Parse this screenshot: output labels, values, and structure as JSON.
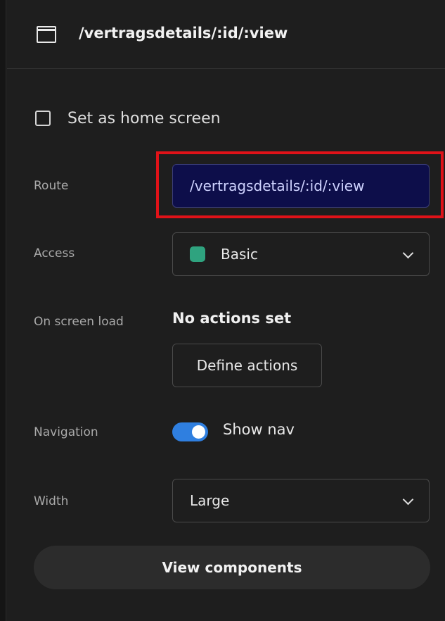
{
  "header": {
    "title": "/vertragsdetails/:id/:view",
    "icon": "screen-icon"
  },
  "home_screen": {
    "label": "Set as home screen",
    "checked": false
  },
  "route": {
    "label": "Route",
    "value": "/vertragsdetails/:id/:view"
  },
  "access": {
    "label": "Access",
    "value": "Basic",
    "dot_color": "#2fa37f"
  },
  "on_screen_load": {
    "label": "On screen load",
    "status": "No actions set",
    "button_label": "Define actions"
  },
  "navigation": {
    "label": "Navigation",
    "toggle_label": "Show nav",
    "enabled": true,
    "toggle_color": "#2f7fe0"
  },
  "width": {
    "label": "Width",
    "value": "Large"
  },
  "view_components_label": "View components",
  "colors": {
    "background": "#1e1e1e",
    "highlight": "#e01218",
    "route_input_bg": "#0d0e4a"
  }
}
